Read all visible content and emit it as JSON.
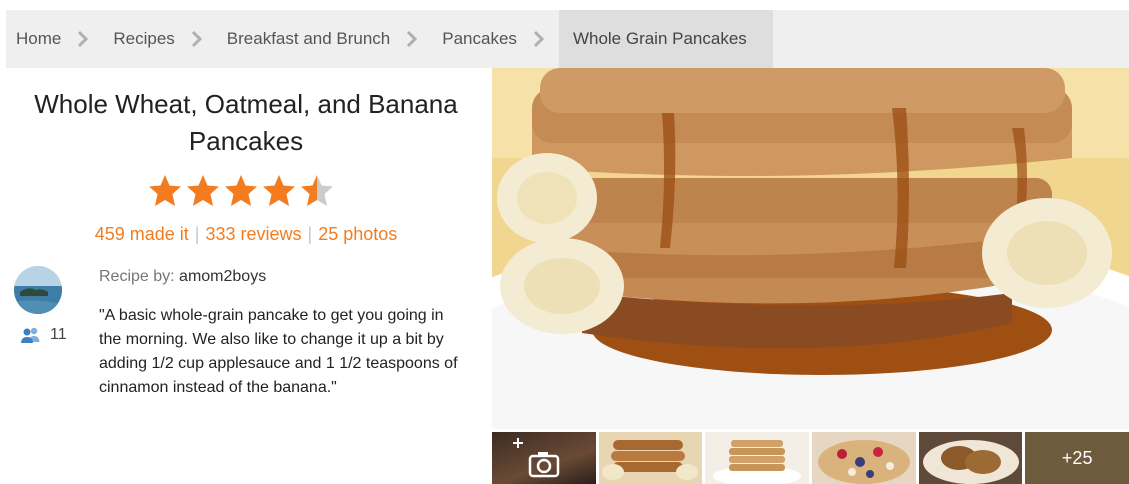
{
  "breadcrumb": {
    "items": [
      "Home",
      "Recipes",
      "Breakfast and Brunch",
      "Pancakes",
      "Whole Grain Pancakes"
    ]
  },
  "recipe": {
    "title": "Whole Wheat, Oatmeal, and Banana Pancakes",
    "rating": 4.5,
    "rating_max": 5,
    "made_it": "459 made it",
    "reviews": "333 reviews",
    "photos": "25 photos",
    "recipe_by_label": "Recipe by:",
    "author": "amom2boys",
    "followers": "11",
    "description": "\"A basic whole-grain pancake to get you going in the morning. We also like to change it up a bit by adding 1/2 cup applesauce and 1 1/2 teaspoons of cinnamon instead of the banana.\""
  },
  "gallery": {
    "more_label": "+25"
  },
  "icons": [
    "chevron-right-icon",
    "star-icon",
    "followers-icon",
    "add-photo-icon"
  ],
  "colors": {
    "accent": "#f27c1f",
    "star_empty": "#cccccc",
    "breadcrumb_bg": "#efefef",
    "breadcrumb_active_bg": "#dedede",
    "followers_icon": "#4a90c8"
  }
}
